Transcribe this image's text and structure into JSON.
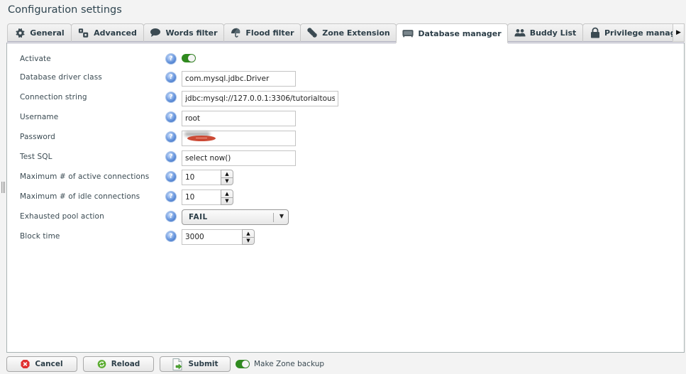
{
  "window": {
    "title": "Configuration settings"
  },
  "tabs": [
    {
      "label": "General",
      "icon": "gear-icon",
      "active": false
    },
    {
      "label": "Advanced",
      "icon": "gears-icon",
      "active": false
    },
    {
      "label": "Words filter",
      "icon": "speech-bubble-icon",
      "active": false
    },
    {
      "label": "Flood filter",
      "icon": "umbrella-icon",
      "active": false
    },
    {
      "label": "Zone Extension",
      "icon": "puzzle-link-icon",
      "active": false
    },
    {
      "label": "Database manager",
      "icon": "database-icon",
      "active": true
    },
    {
      "label": "Buddy List",
      "icon": "users-icon",
      "active": false
    },
    {
      "label": "Privilege manage",
      "icon": "lock-icon",
      "active": false
    }
  ],
  "tab_scroll_glyph": "▶",
  "help_glyph": "?",
  "form": {
    "activate": {
      "label": "Activate",
      "value": true
    },
    "driver_class": {
      "label": "Database driver class",
      "value": "com.mysql.jdbc.Driver"
    },
    "connection_string": {
      "label": "Connection string",
      "value": "jdbc:mysql://127.0.0.1:3306/tutorialtous"
    },
    "username": {
      "label": "Username",
      "value": "root"
    },
    "password": {
      "label": "Password",
      "value": ""
    },
    "test_sql": {
      "label": "Test SQL",
      "value": "select now()"
    },
    "max_active": {
      "label": "Maximum # of active connections",
      "value": "10"
    },
    "max_idle": {
      "label": "Maximum # of idle connections",
      "value": "10"
    },
    "exhausted_action": {
      "label": "Exhausted pool action",
      "value": "FAIL"
    },
    "block_time": {
      "label": "Block time",
      "value": "3000"
    }
  },
  "stepper": {
    "up": "▲",
    "down": "▼"
  },
  "dropdown_arrow": "▼",
  "footer": {
    "cancel": "Cancel",
    "reload": "Reload",
    "submit": "Submit",
    "make_backup": {
      "label": "Make Zone backup",
      "value": true
    }
  },
  "colors": {
    "toggle_on": "#2f8a1e",
    "help_icon": "#5e8ed8",
    "cancel_icon": "#e03030",
    "reload_icon": "#5cad32"
  }
}
